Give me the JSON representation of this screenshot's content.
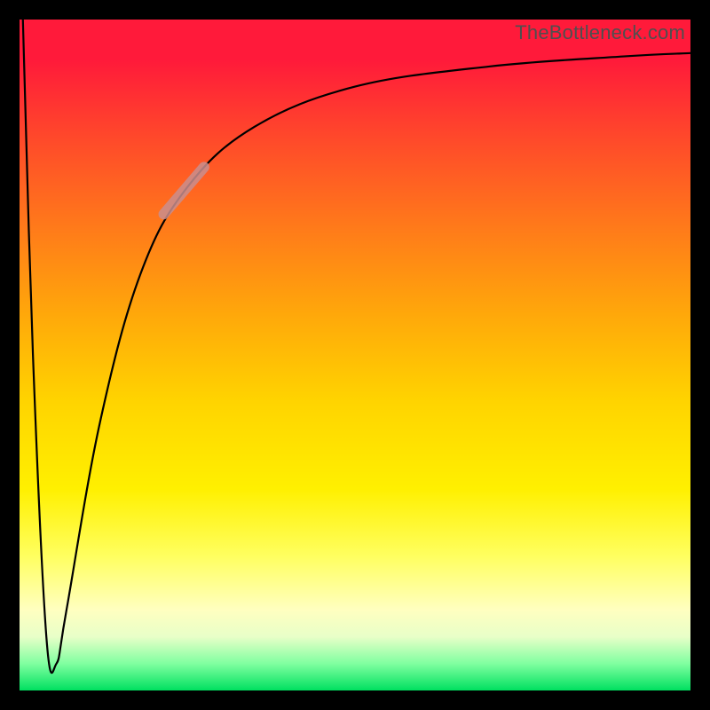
{
  "watermark": "TheBottleneck.com",
  "chart_data": {
    "type": "line",
    "title": "",
    "xlabel": "",
    "ylabel": "",
    "xlim": [
      0,
      100
    ],
    "ylim": [
      0,
      100
    ],
    "grid": false,
    "legend": false,
    "series": [
      {
        "name": "curve",
        "x": [
          0.5,
          2,
          4,
          5.5,
          7,
          12,
          18,
          25,
          35,
          50,
          70,
          90,
          100
        ],
        "y": [
          100,
          50,
          8,
          4,
          12,
          40,
          62,
          75,
          84,
          90,
          93,
          94.5,
          95
        ]
      }
    ],
    "highlight_segment": {
      "name": "bulge",
      "x": [
        21.5,
        27.5
      ],
      "y": [
        71,
        78
      ]
    },
    "background_gradient_stops": [
      {
        "pos": 0,
        "color": "#ff1a3a"
      },
      {
        "pos": 6,
        "color": "#ff1a3a"
      },
      {
        "pos": 18,
        "color": "#ff4a2a"
      },
      {
        "pos": 31,
        "color": "#ff7a1a"
      },
      {
        "pos": 44,
        "color": "#ffa80a"
      },
      {
        "pos": 57,
        "color": "#ffd400"
      },
      {
        "pos": 70,
        "color": "#fff000"
      },
      {
        "pos": 80,
        "color": "#ffff60"
      },
      {
        "pos": 88,
        "color": "#ffffc0"
      },
      {
        "pos": 92,
        "color": "#e8ffc8"
      },
      {
        "pos": 96,
        "color": "#80ffa0"
      },
      {
        "pos": 100,
        "color": "#00e060"
      }
    ]
  }
}
